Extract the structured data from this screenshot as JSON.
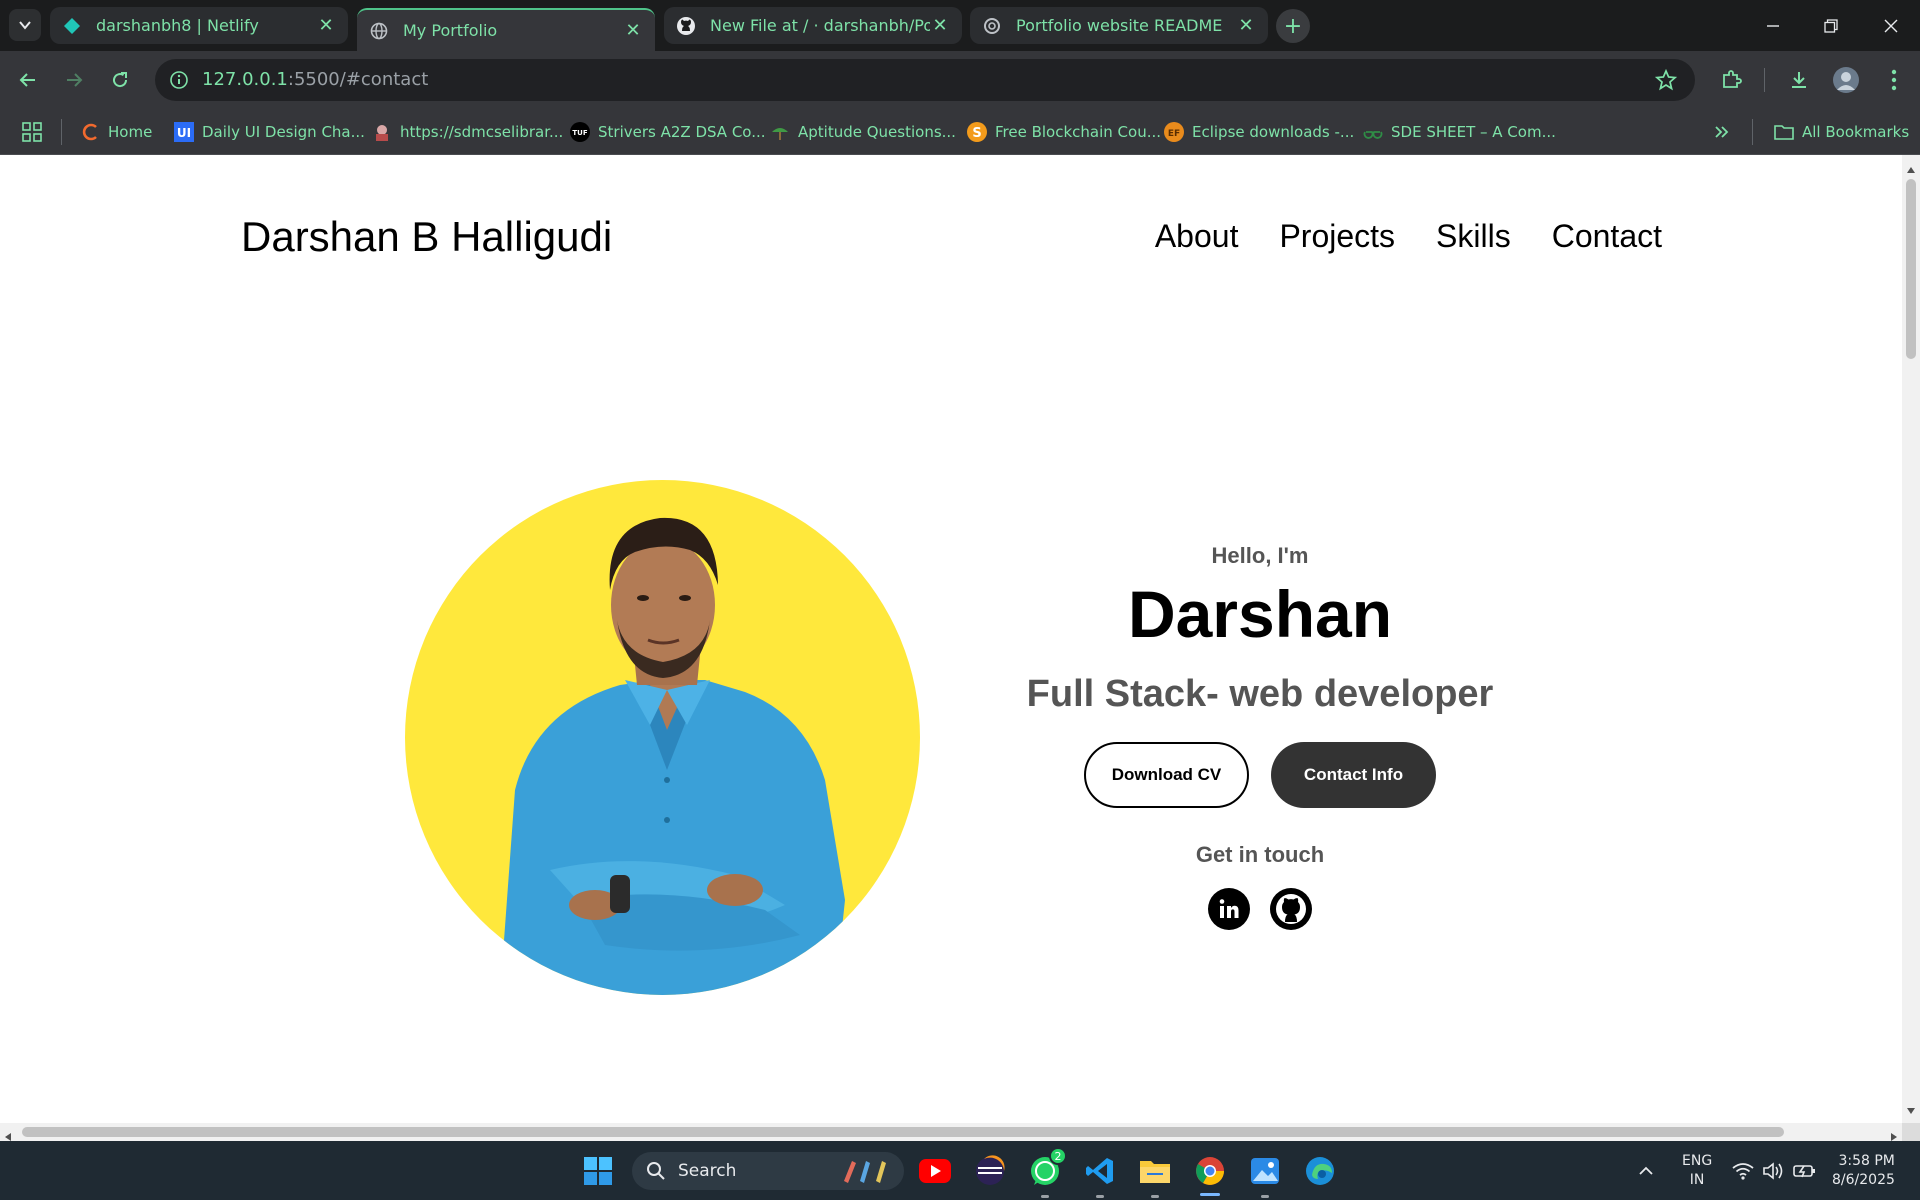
{
  "browser": {
    "tabs": [
      {
        "title": "darshanbh8 | Netlify",
        "icon": "netlify-icon",
        "active": false
      },
      {
        "title": "My Portfolio",
        "icon": "globe-icon",
        "active": true
      },
      {
        "title": "New File at / · darshanbh/Portfo",
        "icon": "github-icon",
        "active": false
      },
      {
        "title": "Portfolio website README",
        "icon": "openai-icon",
        "active": false
      }
    ],
    "url_host": "127.0.0.1",
    "url_rest": ":5500/#contact",
    "bookmarks": [
      {
        "label": "Home",
        "icon": "coursera-icon"
      },
      {
        "label": "Daily UI Design Cha...",
        "icon": "ui-icon"
      },
      {
        "label": "https://sdmcselibrar...",
        "icon": "library-icon"
      },
      {
        "label": "Strivers A2Z DSA Co...",
        "icon": "tuf-icon"
      },
      {
        "label": "Aptitude Questions...",
        "icon": "indiabix-icon"
      },
      {
        "label": "Free Blockchain Cou...",
        "icon": "s-icon"
      },
      {
        "label": "Eclipse downloads -...",
        "icon": "eclipse-icon"
      },
      {
        "label": "SDE SHEET – A Com...",
        "icon": "gfg-icon"
      }
    ],
    "all_bookmarks": "All Bookmarks",
    "accent": "#7ee2a8"
  },
  "page": {
    "logo": "Darshan B Halligudi",
    "nav": [
      "About",
      "Projects",
      "Skills",
      "Contact"
    ],
    "hello": "Hello, I'm",
    "name": "Darshan",
    "role": "Full Stack- web developer",
    "download_cv": "Download CV",
    "contact_info": "Contact Info",
    "get_in_touch": "Get in touch",
    "profile_bg": "#ffe83c"
  },
  "taskbar": {
    "search": "Search",
    "whatsapp_badge": "2",
    "lang_top": "ENG",
    "lang_bottom": "IN",
    "time": "3:58 PM",
    "date": "8/6/2025"
  }
}
